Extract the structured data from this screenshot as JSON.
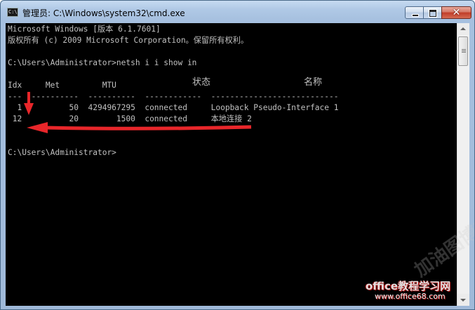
{
  "window": {
    "title": "管理员: C:\\Windows\\system32\\cmd.exe",
    "icon": "cmd-icon",
    "buttons": [
      "minimize-icon",
      "maximize-icon",
      "close-icon"
    ]
  },
  "console": {
    "lines": [
      "Microsoft Windows [版本 6.1.7601]",
      "版权所有 (c) 2009 Microsoft Corporation。保留所有权利。",
      "",
      "C:\\Users\\Administrator>netsh i i show in",
      "",
      "Idx     Met         MTU          ",
      "---  ----------  ----------  ------------  ---------------------------",
      "  1          50  4294967295  connected     Loopback Pseudo-Interface 1",
      " 12          20        1500  connected     本地连接 2",
      "",
      "",
      "C:\\Users\\Administrator>"
    ],
    "header_state": "状态",
    "header_name": "名称"
  },
  "annotations": {
    "arrow_color": "#e8262a"
  },
  "watermark": {
    "site_name": "office教程学习网",
    "site_url": "www.office68.com",
    "stamp": "加油图博客"
  },
  "colors": {
    "console_bg": "#000000",
    "console_fg": "#c0c0c0",
    "close_button": "#c13c28"
  }
}
